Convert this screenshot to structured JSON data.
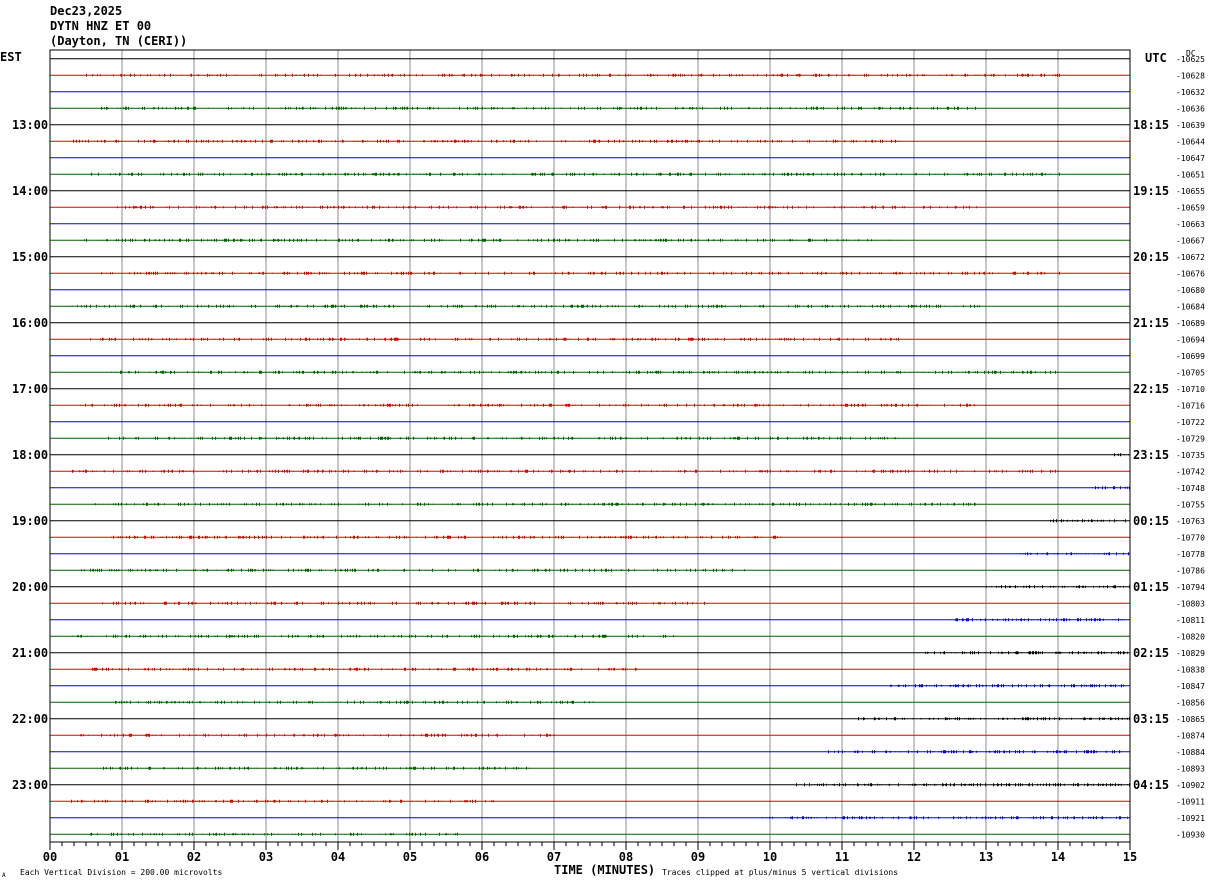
{
  "header": {
    "date": "Dec23,2025",
    "station": "DYTN HNZ ET 00",
    "location": "(Dayton, TN (CERI))"
  },
  "labels": {
    "left_zone": "EST",
    "right_zone": "UTC",
    "dc_label": "DC"
  },
  "footer": {
    "scale_note": "Each Vertical Division =  200.00 microvolts",
    "xlabel": "TIME (MINUTES)",
    "clip_note": "Traces clipped at plus/minus 5 vertical divisions",
    "corner_mark": "A"
  },
  "colors": {
    "black": "#000000",
    "red": "#e00000",
    "blue": "#0000ee",
    "green": "#006400",
    "grid": "#8c8c8c"
  },
  "chart_data": {
    "type": "line",
    "title": "DYTN HNZ ET 00",
    "xlabel": "TIME (MINUTES)",
    "xlim": [
      0,
      15
    ],
    "x_ticks": [
      "00",
      "01",
      "02",
      "03",
      "04",
      "05",
      "06",
      "07",
      "08",
      "09",
      "10",
      "11",
      "12",
      "13",
      "14",
      "15"
    ],
    "left_hour_labels": [
      "13:00",
      "14:00",
      "15:00",
      "16:00",
      "17:00",
      "18:00",
      "19:00",
      "20:00",
      "21:00",
      "22:00",
      "23:00"
    ],
    "right_hour_labels": [
      "18:15",
      "19:15",
      "20:15",
      "21:15",
      "22:15",
      "23:15",
      "00:15",
      "01:15",
      "02:15",
      "03:15",
      "04:15"
    ],
    "dc_offsets": [
      "-10625",
      "-10628",
      "-10632",
      "-10636",
      "-10639",
      "-10644",
      "-10647",
      "-10651",
      "-10655",
      "-10659",
      "-10663",
      "-10667",
      "-10672",
      "-10676",
      "-10680",
      "-10684",
      "-10689",
      "-10694",
      "-10699",
      "-10705",
      "-10710",
      "-10716",
      "-10722",
      "-10729",
      "-10735",
      "-10742",
      "-10748",
      "-10755",
      "-10763",
      "-10770",
      "-10778",
      "-10786",
      "-10794",
      "-10803",
      "-10811",
      "-10820",
      "-10829",
      "-10838",
      "-10847",
      "-10856",
      "-10865",
      "-10874",
      "-10884",
      "-10893",
      "-10902",
      "-10911",
      "-10921",
      "-10930"
    ],
    "trace_color_cycle": [
      "black",
      "red",
      "blue",
      "green"
    ],
    "trace_count": 48
  }
}
